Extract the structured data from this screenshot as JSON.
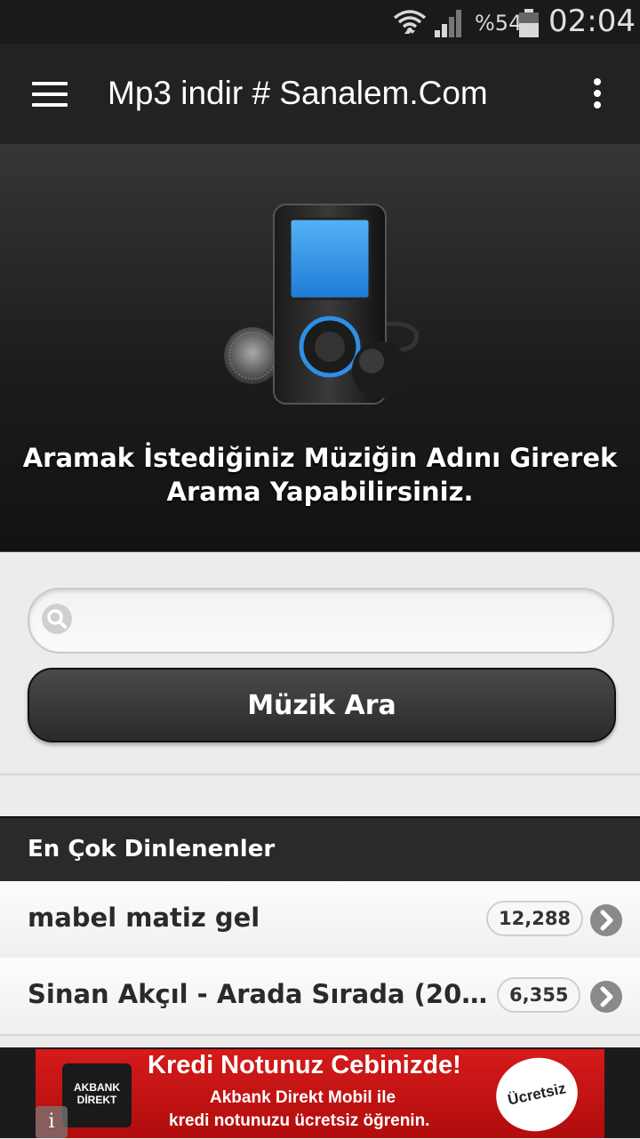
{
  "status_bar": {
    "battery": "%54",
    "time": "02:04",
    "icons": [
      "wifi-icon",
      "signal-icon",
      "battery-icon"
    ]
  },
  "app_bar": {
    "title": "Mp3 indir # Sanalem.Com",
    "icons": [
      "menu-icon",
      "more-vert-icon"
    ]
  },
  "hero": {
    "line1": "Aramak İstediğiniz Müziğin Adını Girerek",
    "line2": "Arama Yapabilirsiniz."
  },
  "search": {
    "value": "",
    "placeholder": "",
    "button_label": "Müzik Ara"
  },
  "top_list": {
    "header": "En Çok Dinlenenler",
    "items": [
      {
        "title": "mabel matiz gel",
        "count": "12,288"
      },
      {
        "title": "Sinan Akçıl - Arada Sırada (2015) #...",
        "count": "6,355"
      }
    ]
  },
  "ad": {
    "logo": "AKBANK DİREKT",
    "headline": "Kredi Notunuz Cebinizde!",
    "line1": "Akbank Direkt Mobil ile",
    "line2": "kredi notunuzu ücretsiz öğrenin.",
    "badge": "Ücretsiz",
    "info": "i"
  },
  "colors": {
    "app_bar": "#222222",
    "status_bar": "#1a1a1a",
    "ad_red": "#c8141a",
    "player_screen_blue": "#2f8fe6"
  }
}
